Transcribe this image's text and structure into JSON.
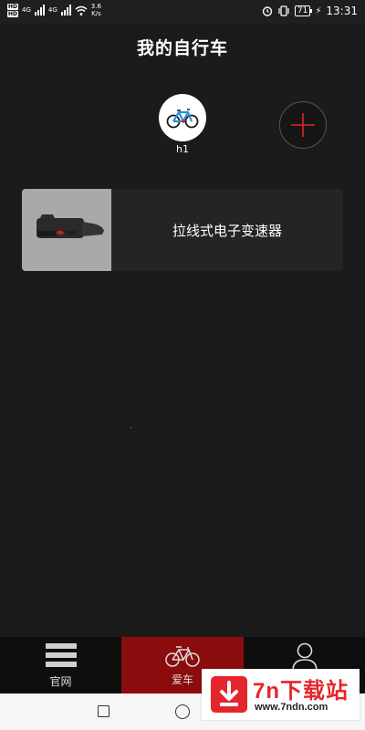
{
  "status_bar": {
    "hd1": "HD",
    "hd2": "HD",
    "net1": "4G",
    "net2": "4G",
    "speed_value": "3.6",
    "speed_unit": "K/s",
    "battery": "71",
    "time": "13:31"
  },
  "header": {
    "title": "我的自行车"
  },
  "bikes": [
    {
      "name": "h1",
      "icon": "bicycle-icon"
    }
  ],
  "add_icon": "plus-icon",
  "device": {
    "name": "拉线式电子变速器",
    "image": "electronic-shifter"
  },
  "tabs": [
    {
      "label": "官网",
      "icon": "menu-lines-icon",
      "active": false
    },
    {
      "label": "爱车",
      "icon": "bicycle-icon",
      "active": true
    },
    {
      "label": "",
      "icon": "user-icon",
      "active": false
    }
  ],
  "colors": {
    "background": "#1b1b1b",
    "active_tab": "#8b0c0c",
    "accent": "#e0262c"
  },
  "watermark": {
    "title": "7n下载站",
    "url": "www.7ndn.com"
  }
}
